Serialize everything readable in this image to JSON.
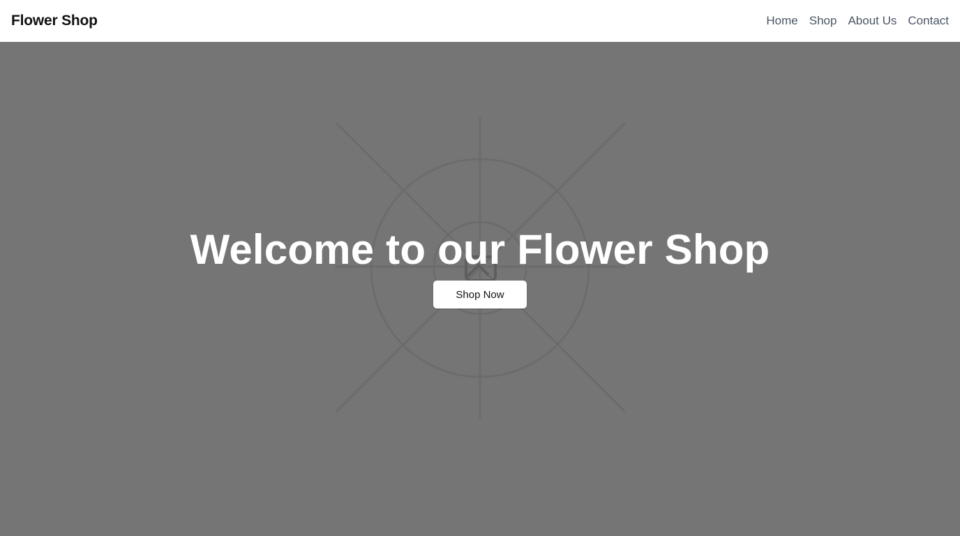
{
  "navbar": {
    "brand": "Flower Shop",
    "links": [
      {
        "label": "Home"
      },
      {
        "label": "Shop"
      },
      {
        "label": "About Us"
      },
      {
        "label": "Contact"
      }
    ]
  },
  "hero": {
    "title": "Welcome to our Flower Shop",
    "button_label": "Shop Now",
    "background_icon": "image-placeholder-icon",
    "background_color": "#757575"
  }
}
